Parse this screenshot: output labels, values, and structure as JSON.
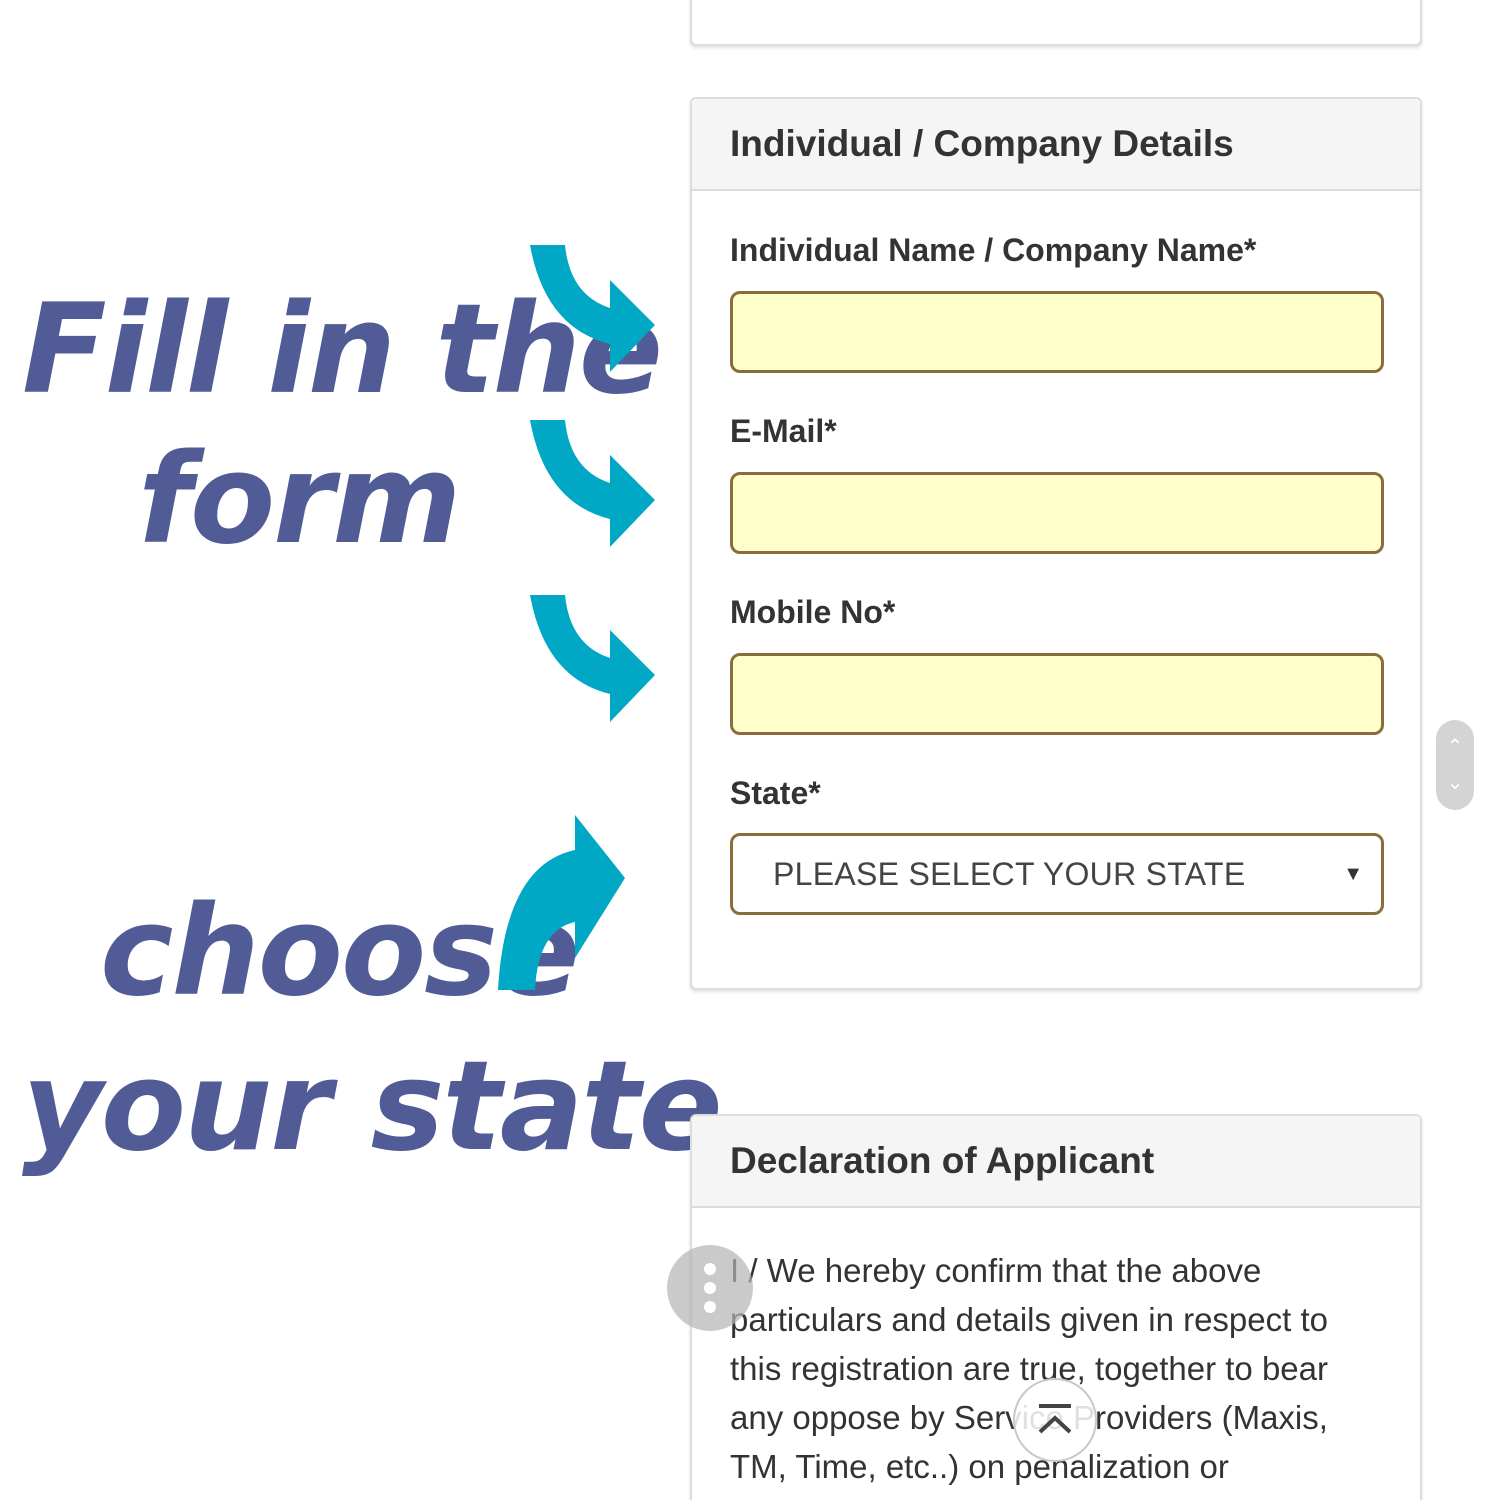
{
  "annotations": {
    "line1": "Fill in the",
    "line2": "form",
    "line3": "choose",
    "line4": "your state",
    "text_color": "#515c96",
    "arrow_color": "#00a8c6"
  },
  "details_panel": {
    "title": "Individual / Company Details",
    "name_label": "Individual Name / Company Name*",
    "name_value": "",
    "email_label": "E-Mail*",
    "email_value": "",
    "mobile_label": "Mobile No*",
    "mobile_value": "",
    "state_label": "State*",
    "state_selected": "PLEASE SELECT YOUR STATE",
    "input_bg_color": "#ffffcc",
    "input_border_color": "#8a6d3b"
  },
  "declaration_panel": {
    "title": "Declaration of Applicant",
    "body": "I / We hereby confirm that the above particulars and details given in respect to this registration are true, together to bear any oppose by Service Providers (Maxis, TM, Time, etc..) on penalization or"
  },
  "icons": {
    "scroll_up": "chevron-up-icon",
    "scroll_down": "chevron-down-icon",
    "menu": "more-vertical-icon",
    "back_to_top": "back-to-top-icon",
    "select_caret": "caret-down-icon"
  }
}
